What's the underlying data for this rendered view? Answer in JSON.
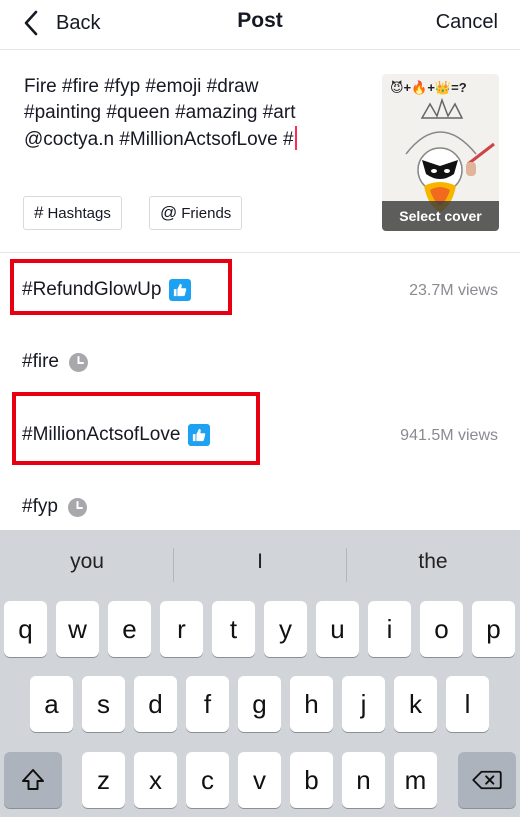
{
  "header": {
    "back_label": "Back",
    "title": "Post",
    "cancel_label": "Cancel"
  },
  "caption": {
    "line1": "Fire #fire #fyp #emoji #draw",
    "line2": "#painting #queen #amazing #art",
    "line3": "@coctya.n #MillionActsofLove #"
  },
  "cover": {
    "emoji_text": "😈+🔥+👑=?",
    "select_label": "Select cover"
  },
  "chips": {
    "hashtags": "Hashtags",
    "friends": "Friends"
  },
  "suggestions": [
    {
      "tag": "#RefundGlowUp",
      "views": "23.7M views",
      "icon": "thumbs-up-icon"
    },
    {
      "tag": "#fire",
      "views": "",
      "icon": "clock-icon"
    },
    {
      "tag": "#MillionActsofLove",
      "views": "941.5M views",
      "icon": "thumbs-up-icon"
    },
    {
      "tag": "#fyp",
      "views": "",
      "icon": "clock-icon"
    }
  ],
  "keyboard": {
    "predictions": [
      "you",
      "I",
      "the"
    ],
    "row1": [
      "q",
      "w",
      "e",
      "r",
      "t",
      "y",
      "u",
      "i",
      "o",
      "p"
    ],
    "row2": [
      "a",
      "s",
      "d",
      "f",
      "g",
      "h",
      "j",
      "k",
      "l"
    ],
    "row3": [
      "z",
      "x",
      "c",
      "v",
      "b",
      "n",
      "m"
    ]
  },
  "colors": {
    "accent_caret": "#fe2c55",
    "highlight_box": "#e60012",
    "badge_blue": "#1da1f2"
  }
}
